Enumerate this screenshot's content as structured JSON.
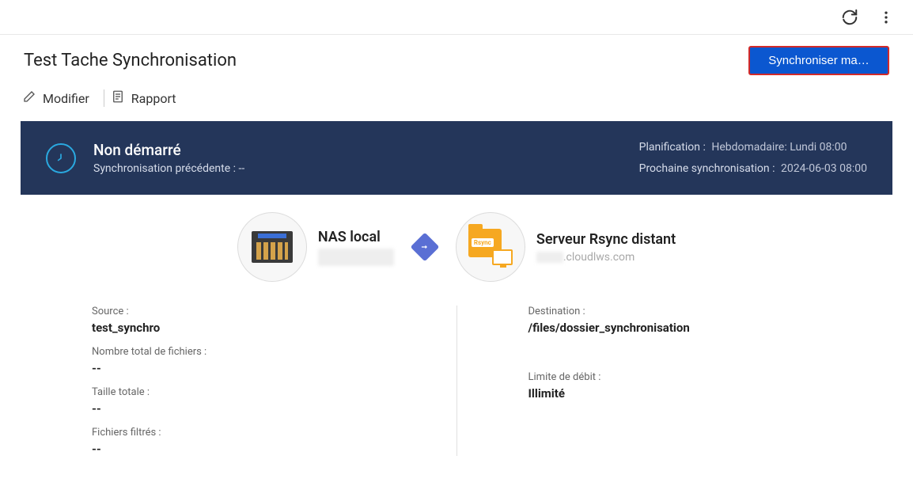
{
  "header": {
    "title": "Test Tache Synchronisation",
    "sync_button": "Synchroniser ma…"
  },
  "actions": {
    "modify": "Modifier",
    "report": "Rapport"
  },
  "status": {
    "title": "Non démarré",
    "prev_sync_label": "Synchronisation précédente :",
    "prev_sync_value": "--",
    "planning_label": "Planification :",
    "planning_value": "Hebdomadaire: Lundi 08:00",
    "next_sync_label": "Prochaine synchronisation :",
    "next_sync_value": "2024-06-03 08:00"
  },
  "endpoints": {
    "source": {
      "title": "NAS local",
      "host_masked": true
    },
    "dest": {
      "title": "Serveur Rsync distant",
      "host_suffix": ".cloudlws.com"
    },
    "rsync_tag": "Rsync"
  },
  "details": {
    "left": {
      "source_label": "Source :",
      "source_value": "test_synchro",
      "total_files_label": "Nombre total de fichiers :",
      "total_files_value": "--",
      "total_size_label": "Taille totale :",
      "total_size_value": "--",
      "filtered_label": "Fichiers filtrés :",
      "filtered_value": "--"
    },
    "right": {
      "dest_label": "Destination :",
      "dest_value": "/files/dossier_synchronisation",
      "limit_label": "Limite de débit :",
      "limit_value": "Illimité"
    }
  }
}
